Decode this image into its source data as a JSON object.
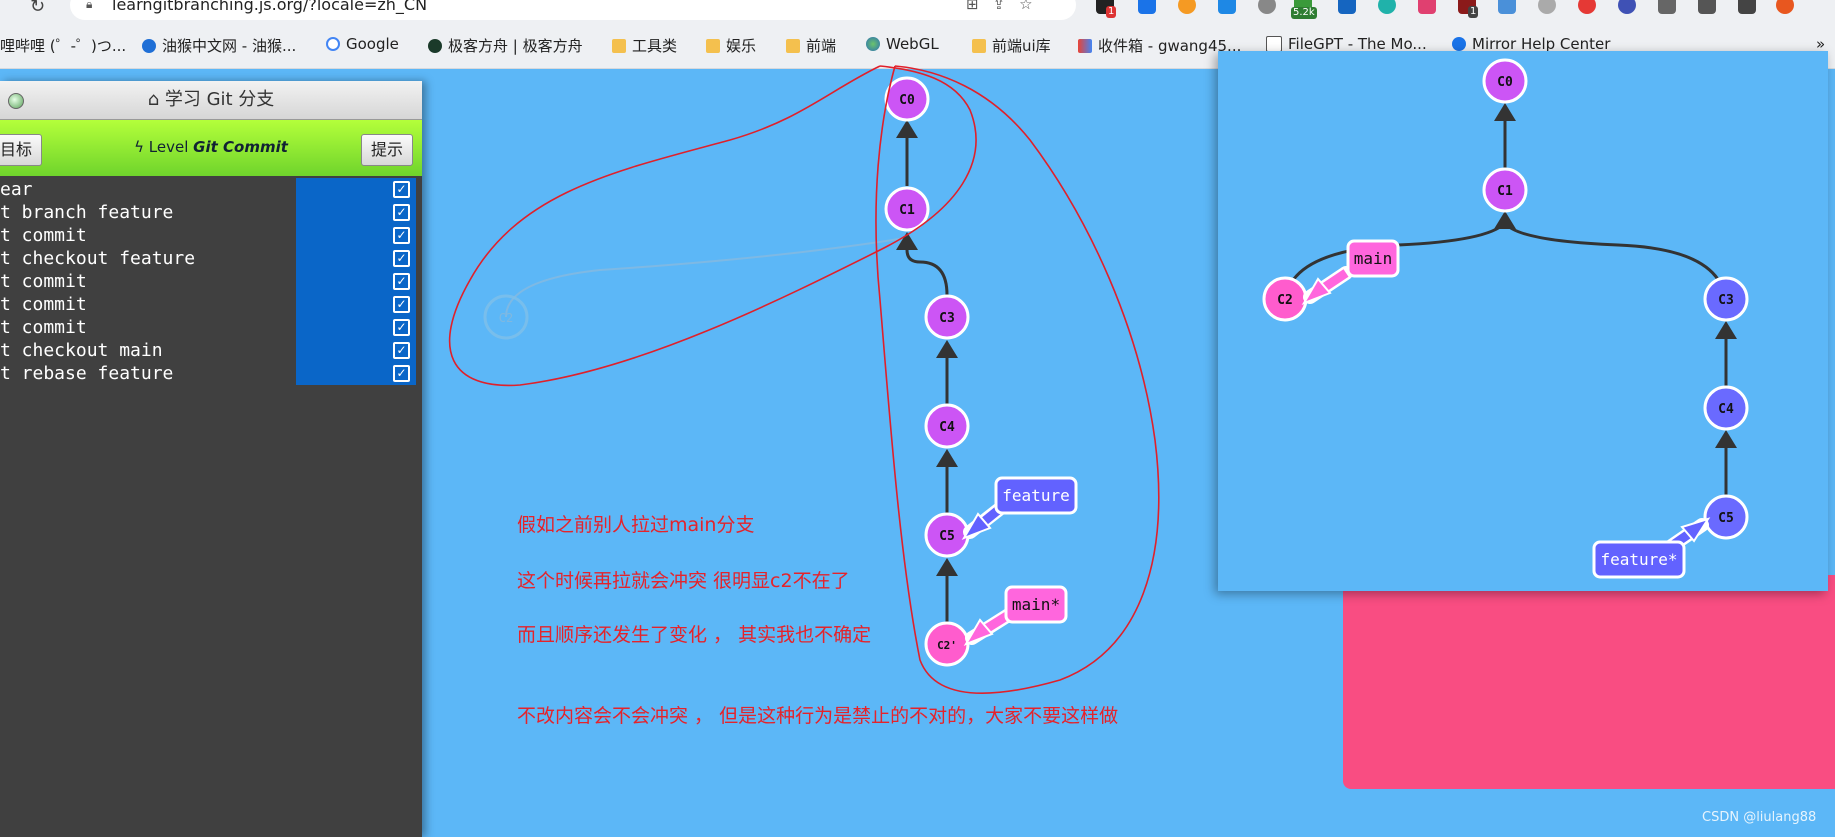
{
  "browser": {
    "url": "learngitbranching.js.org/?locale=zh_CN",
    "ext_badges": [
      "1",
      "5.2k",
      "1"
    ],
    "bookmarks": [
      {
        "label": "哩哔哩 (゜-゜)つ...",
        "icon": "bilibili-icon"
      },
      {
        "label": "油猴中文网 - 油猴...",
        "icon": "tampermonkey-icon"
      },
      {
        "label": "Google",
        "icon": "google-icon"
      },
      {
        "label": "极客方舟 | 极客方舟",
        "icon": "site-icon"
      },
      {
        "label": "工具类",
        "icon": "folder-icon"
      },
      {
        "label": "娱乐",
        "icon": "folder-icon"
      },
      {
        "label": "前端",
        "icon": "folder-icon"
      },
      {
        "label": "WebGL",
        "icon": "globe-icon"
      },
      {
        "label": "前端ui库",
        "icon": "folder-icon"
      },
      {
        "label": "收件箱 - gwang45...",
        "icon": "gmail-icon"
      },
      {
        "label": "FileGPT - The Mo...",
        "icon": "file-icon"
      },
      {
        "label": "Mirror Help Center",
        "icon": "help-icon"
      }
    ],
    "more": "»"
  },
  "panel": {
    "title": "学习 Git 分支",
    "goal_button": "目标",
    "hint_button": "提示",
    "level_prefix": "Level",
    "level_name": "Git Commit",
    "commands": [
      "ear",
      "t branch feature",
      "t commit",
      "t checkout feature",
      "t commit",
      "t commit",
      "t commit",
      "t checkout main",
      "t rebase feature"
    ]
  },
  "main_tree": {
    "commits": [
      "C0",
      "C1",
      "C2",
      "C3",
      "C4",
      "C5",
      "C2'"
    ],
    "branches": {
      "feature": "feature",
      "main": "main*"
    }
  },
  "goal_tree": {
    "commits": [
      "C0",
      "C1",
      "C2",
      "C3",
      "C4",
      "C5"
    ],
    "branches": {
      "main": "main",
      "feature": "feature*"
    }
  },
  "notes": [
    "假如之前别人拉过main分支",
    "这个时候再拉就会冲突  很明显c2不在了",
    "而且顺序还发生了变化 ，  其实我也不确定",
    "不改内容会不会冲突 ， 但是这种行为是禁止的不对的，大家不要这样做"
  ],
  "watermark": "CSDN @liulang88",
  "colors": {
    "commit_purple": "#cc55f5",
    "commit_blue": "#6a6aff",
    "commit_pink": "#ff5ccd",
    "branch_blue": "#6262ff",
    "branch_pink": "#ff66dd",
    "annotation_red": "#e5232b",
    "sky": "#5cb7f7"
  }
}
